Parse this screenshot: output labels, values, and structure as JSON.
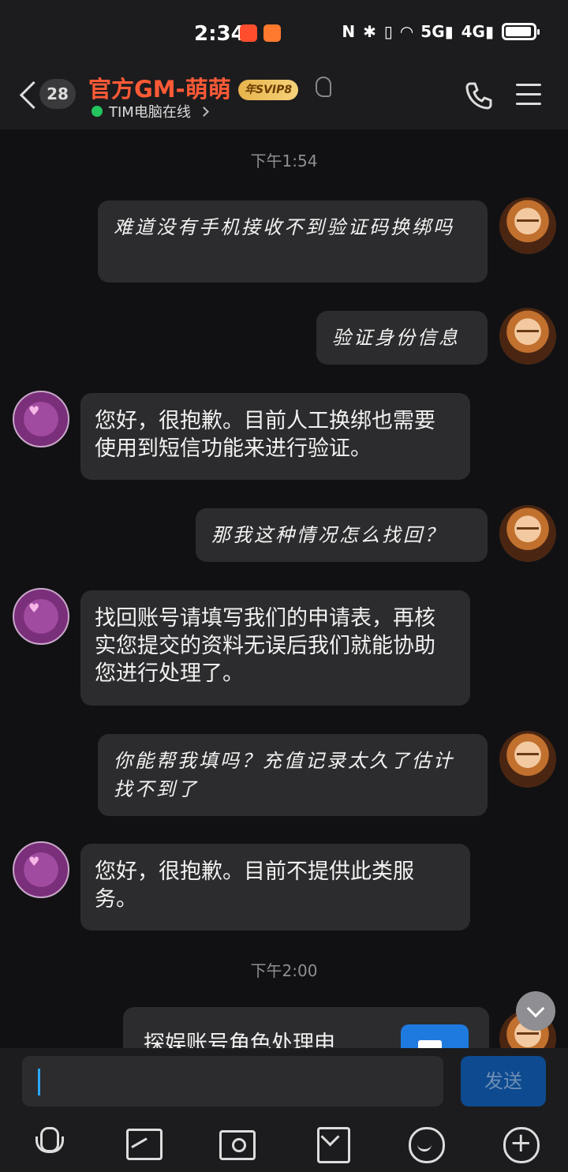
{
  "status_bar": {
    "time": "2:34",
    "network_5g": "5G",
    "network_4g": "4G",
    "icons": [
      "taobao-app-icon",
      "app-icon",
      "nfc-icon",
      "bluetooth-icon",
      "vibrate-icon",
      "wifi-icon",
      "signal-5g-icon",
      "signal-4g-icon",
      "battery-icon"
    ]
  },
  "header": {
    "unread_count": "28",
    "title": "官方GM-萌萌",
    "svip_badge": "年SVIP8",
    "status_text": "TIM电脑在线"
  },
  "chat": {
    "timestamps": [
      "下午1:54",
      "下午2:00"
    ],
    "messages": [
      {
        "from": "me",
        "text": "难道没有手机接收不到验证码换绑吗"
      },
      {
        "from": "me",
        "text": "验证身份信息"
      },
      {
        "from": "gm",
        "text": "您好，很抱歉。目前人工换绑也需要使用到短信功能来进行验证。"
      },
      {
        "from": "me",
        "text": "那我这种情况怎么找回？"
      },
      {
        "from": "gm",
        "text": "找回账号请填写我们的申请表，再核实您提交的资料无误后我们就能协助您进行处理了。"
      },
      {
        "from": "me",
        "text": "你能帮我填吗？充值记录太久了估计找不到了"
      },
      {
        "from": "gm",
        "text": "您好，很抱歉。目前不提供此类服务。"
      }
    ],
    "card_title": "探娱账号角色处理申"
  },
  "input": {
    "send_label": "发送"
  },
  "colors": {
    "accent_title": "#ff5a36",
    "online_dot": "#22c55e",
    "send_button": "#0d4a8f"
  }
}
